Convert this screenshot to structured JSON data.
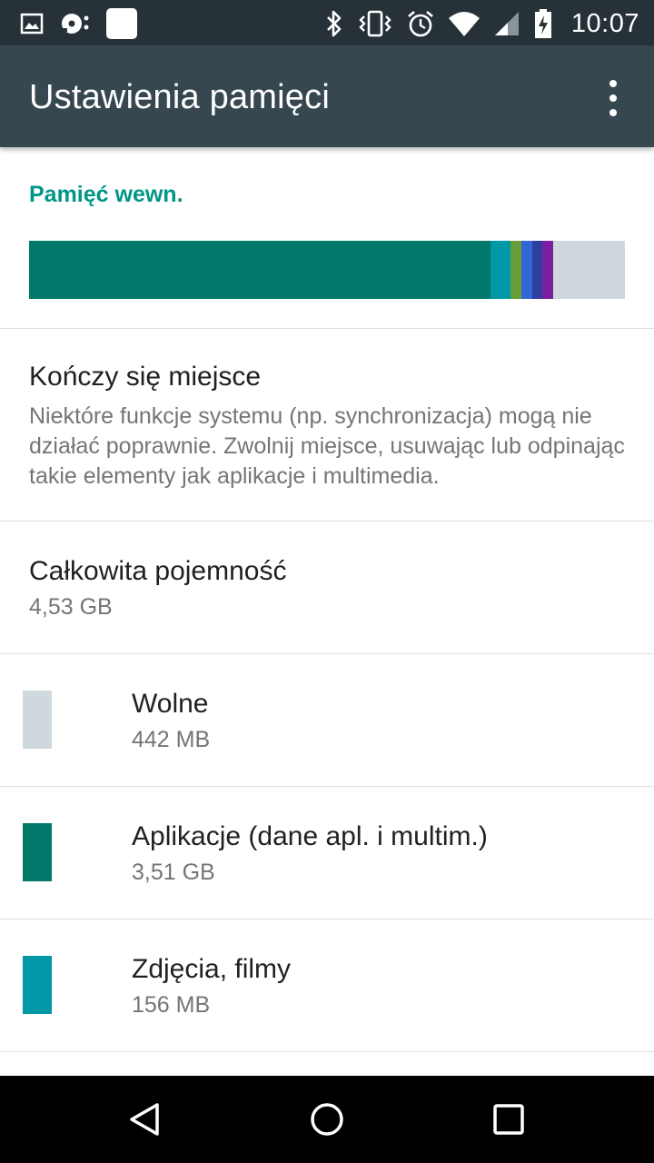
{
  "status_bar": {
    "time": "10:07",
    "icons_left": [
      "image-icon",
      "disc-icon",
      "blank-square-icon"
    ],
    "icons_right": [
      "bluetooth-icon",
      "vibrate-icon",
      "alarm-icon",
      "wifi-icon",
      "signal-icon",
      "battery-charging-icon"
    ]
  },
  "app_bar": {
    "title": "Ustawienia pamięci",
    "overflow_icon": "more-vert-icon"
  },
  "storage": {
    "section_title": "Pamięć wewn.",
    "bar_segments": [
      {
        "category": "apps",
        "color": "#00796b",
        "fraction": 0.774
      },
      {
        "category": "photos",
        "color": "#0097a7",
        "fraction": 0.034
      },
      {
        "category": "green",
        "color": "#689f38",
        "fraction": 0.018
      },
      {
        "category": "blue",
        "color": "#3367d6",
        "fraction": 0.018
      },
      {
        "category": "indigo",
        "color": "#303f9f",
        "fraction": 0.018
      },
      {
        "category": "purple",
        "color": "#7b1fa2",
        "fraction": 0.018
      }
    ],
    "free_color": "#cfd8dc"
  },
  "warning": {
    "title": "Kończy się miejsce",
    "summary": "Niektóre funkcje systemu (np. synchronizacja) mogą nie działać poprawnie. Zwolnij miejsce, usuwając lub odpinając takie elementy jak aplikacje i multimedia."
  },
  "total": {
    "title": "Całkowita pojemność",
    "value": "4,53  GB"
  },
  "categories": [
    {
      "name": "Wolne",
      "size": "442  MB",
      "color": "#cfd8dc"
    },
    {
      "name": "Aplikacje (dane apl. i multim.)",
      "size": "3,51  GB",
      "color": "#00796b"
    },
    {
      "name": "Zdjęcia, filmy",
      "size": "156  MB",
      "color": "#0097a7"
    }
  ],
  "nav_bar": {
    "back_icon": "back-triangle-icon",
    "home_icon": "home-circle-icon",
    "recents_icon": "recents-square-icon"
  }
}
